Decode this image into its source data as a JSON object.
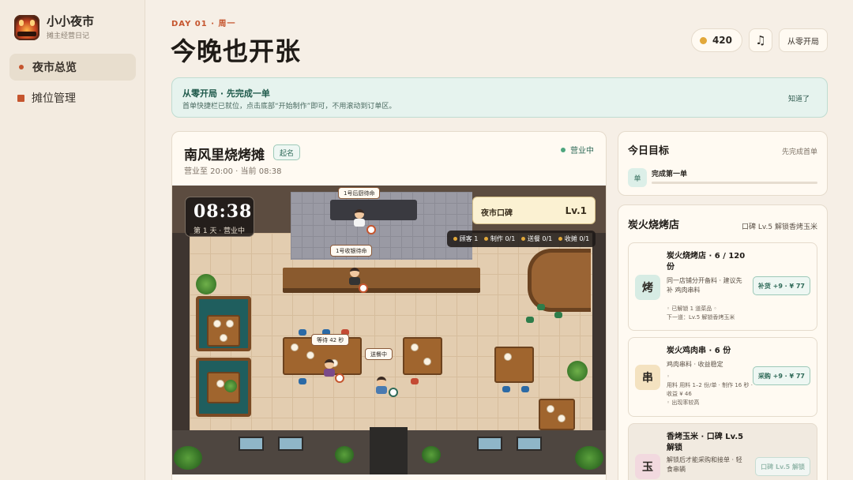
{
  "sidebar": {
    "brand_name": "小小夜市",
    "brand_sub": "摊主经营日记",
    "items": [
      {
        "label": "夜市总览",
        "active": true
      },
      {
        "label": "摊位管理",
        "active": false
      }
    ]
  },
  "header": {
    "day_label": "DAY 01 · 周一",
    "title": "今晚也开张",
    "coins": "420",
    "music_icon": "♫",
    "reset_label": "从零开局"
  },
  "banner": {
    "title": "从零开局 · 先完成一单",
    "text": "首单快捷栏已就位，点击底部“开始制作”即可，不用滚动到订单区。",
    "dismiss_label": "知道了"
  },
  "stall": {
    "name": "南风里烧烤摊",
    "tag": "起名",
    "hours": "营业至 20:00 · 当前 08:38",
    "status": "营业中",
    "status_color": "#4ea57e"
  },
  "scene": {
    "clock_time": "08:38",
    "clock_sub": "第 1 天 · 营业中",
    "reputation_label": "夜市口碑",
    "reputation_level": "Lv.1",
    "stats": [
      {
        "label": "顾客 1"
      },
      {
        "label": "制作 0/1"
      },
      {
        "label": "送餐 0/1"
      },
      {
        "label": "收摊 0/1"
      }
    ],
    "bubbles": {
      "stove": "1号后厨待命",
      "counter": "1号收银待命",
      "waiting": "等待 42 秒",
      "delivering": "送餐中"
    }
  },
  "goal": {
    "title": "今日目标",
    "subtitle": "先完成首单",
    "icon_label": "单",
    "task": "完成第一单",
    "progress": 0
  },
  "shop": {
    "title": "炭火烧烤店",
    "subtitle": "口碑 Lv.5 解锁香烤玉米",
    "items": [
      {
        "icon": "烤",
        "icon_color": "#d7ece4",
        "name": "炭火烧烤店 · 6 / 120 份",
        "desc": "同一店铺分开备料 · 建议先补 鸡肉串料",
        "note": "◦ 已解锁 1 道菜品 ◦\n下一道：Lv.5 解锁香烤玉米",
        "button": "补货 +9 · ¥ 77",
        "locked": false
      },
      {
        "icon": "串",
        "icon_color": "#f4e2c0",
        "name": "炭火鸡肉串 · 6 份",
        "desc": "鸡肉串料 · 收益稳定",
        "note": "◦\n用料 用料 1–2 份/单 · 制作 16 秒 · 收益 ¥ 46\n◦ 出现率较高",
        "button": "采购 +9 · ¥ 77",
        "locked": false
      },
      {
        "icon": "玉",
        "icon_color": "#f2d9df",
        "name": "香烤玉米 · 口碑 Lv.5 解锁",
        "desc": "解锁后才能采购和接单 · 轻食串辆",
        "note": "",
        "button": "口碑 Lv.5 解锁",
        "locked": true
      }
    ]
  }
}
